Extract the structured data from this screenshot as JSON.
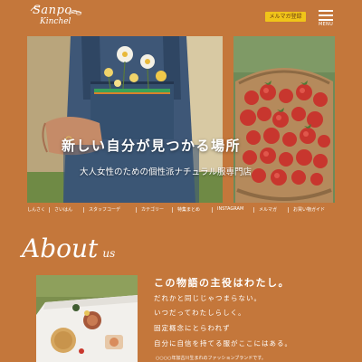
{
  "header": {
    "logo_line1": "Sanpo",
    "logo_line2": "Kinchel",
    "magazine_button": "メルマガ登録",
    "menu_label": "MENU"
  },
  "hero": {
    "title": "新しい自分が見つかる場所",
    "subtitle": "大人女性のための個性派ナチュラル服専門店"
  },
  "nav": {
    "items": [
      "しんさく",
      "さいはん",
      "スタッフコーデ",
      "カテゴリー",
      "特集まとめ",
      "INSTAGRAM",
      "メルマガ",
      "お買い物ガイド"
    ]
  },
  "about": {
    "heading_big": "About",
    "heading_small": "us",
    "headline": "この物語の主役はわたし。",
    "lines": [
      "だれかと同じじゃつまらない。",
      "いつだってわたしらしく。",
      "固定概念にとらわれず",
      "自分に自信を持てる服がここにはある。"
    ],
    "note": "○○○○年加古川生まれのファッションブランドです。"
  },
  "colors": {
    "background": "#c4773b",
    "accent": "#f0c419"
  }
}
